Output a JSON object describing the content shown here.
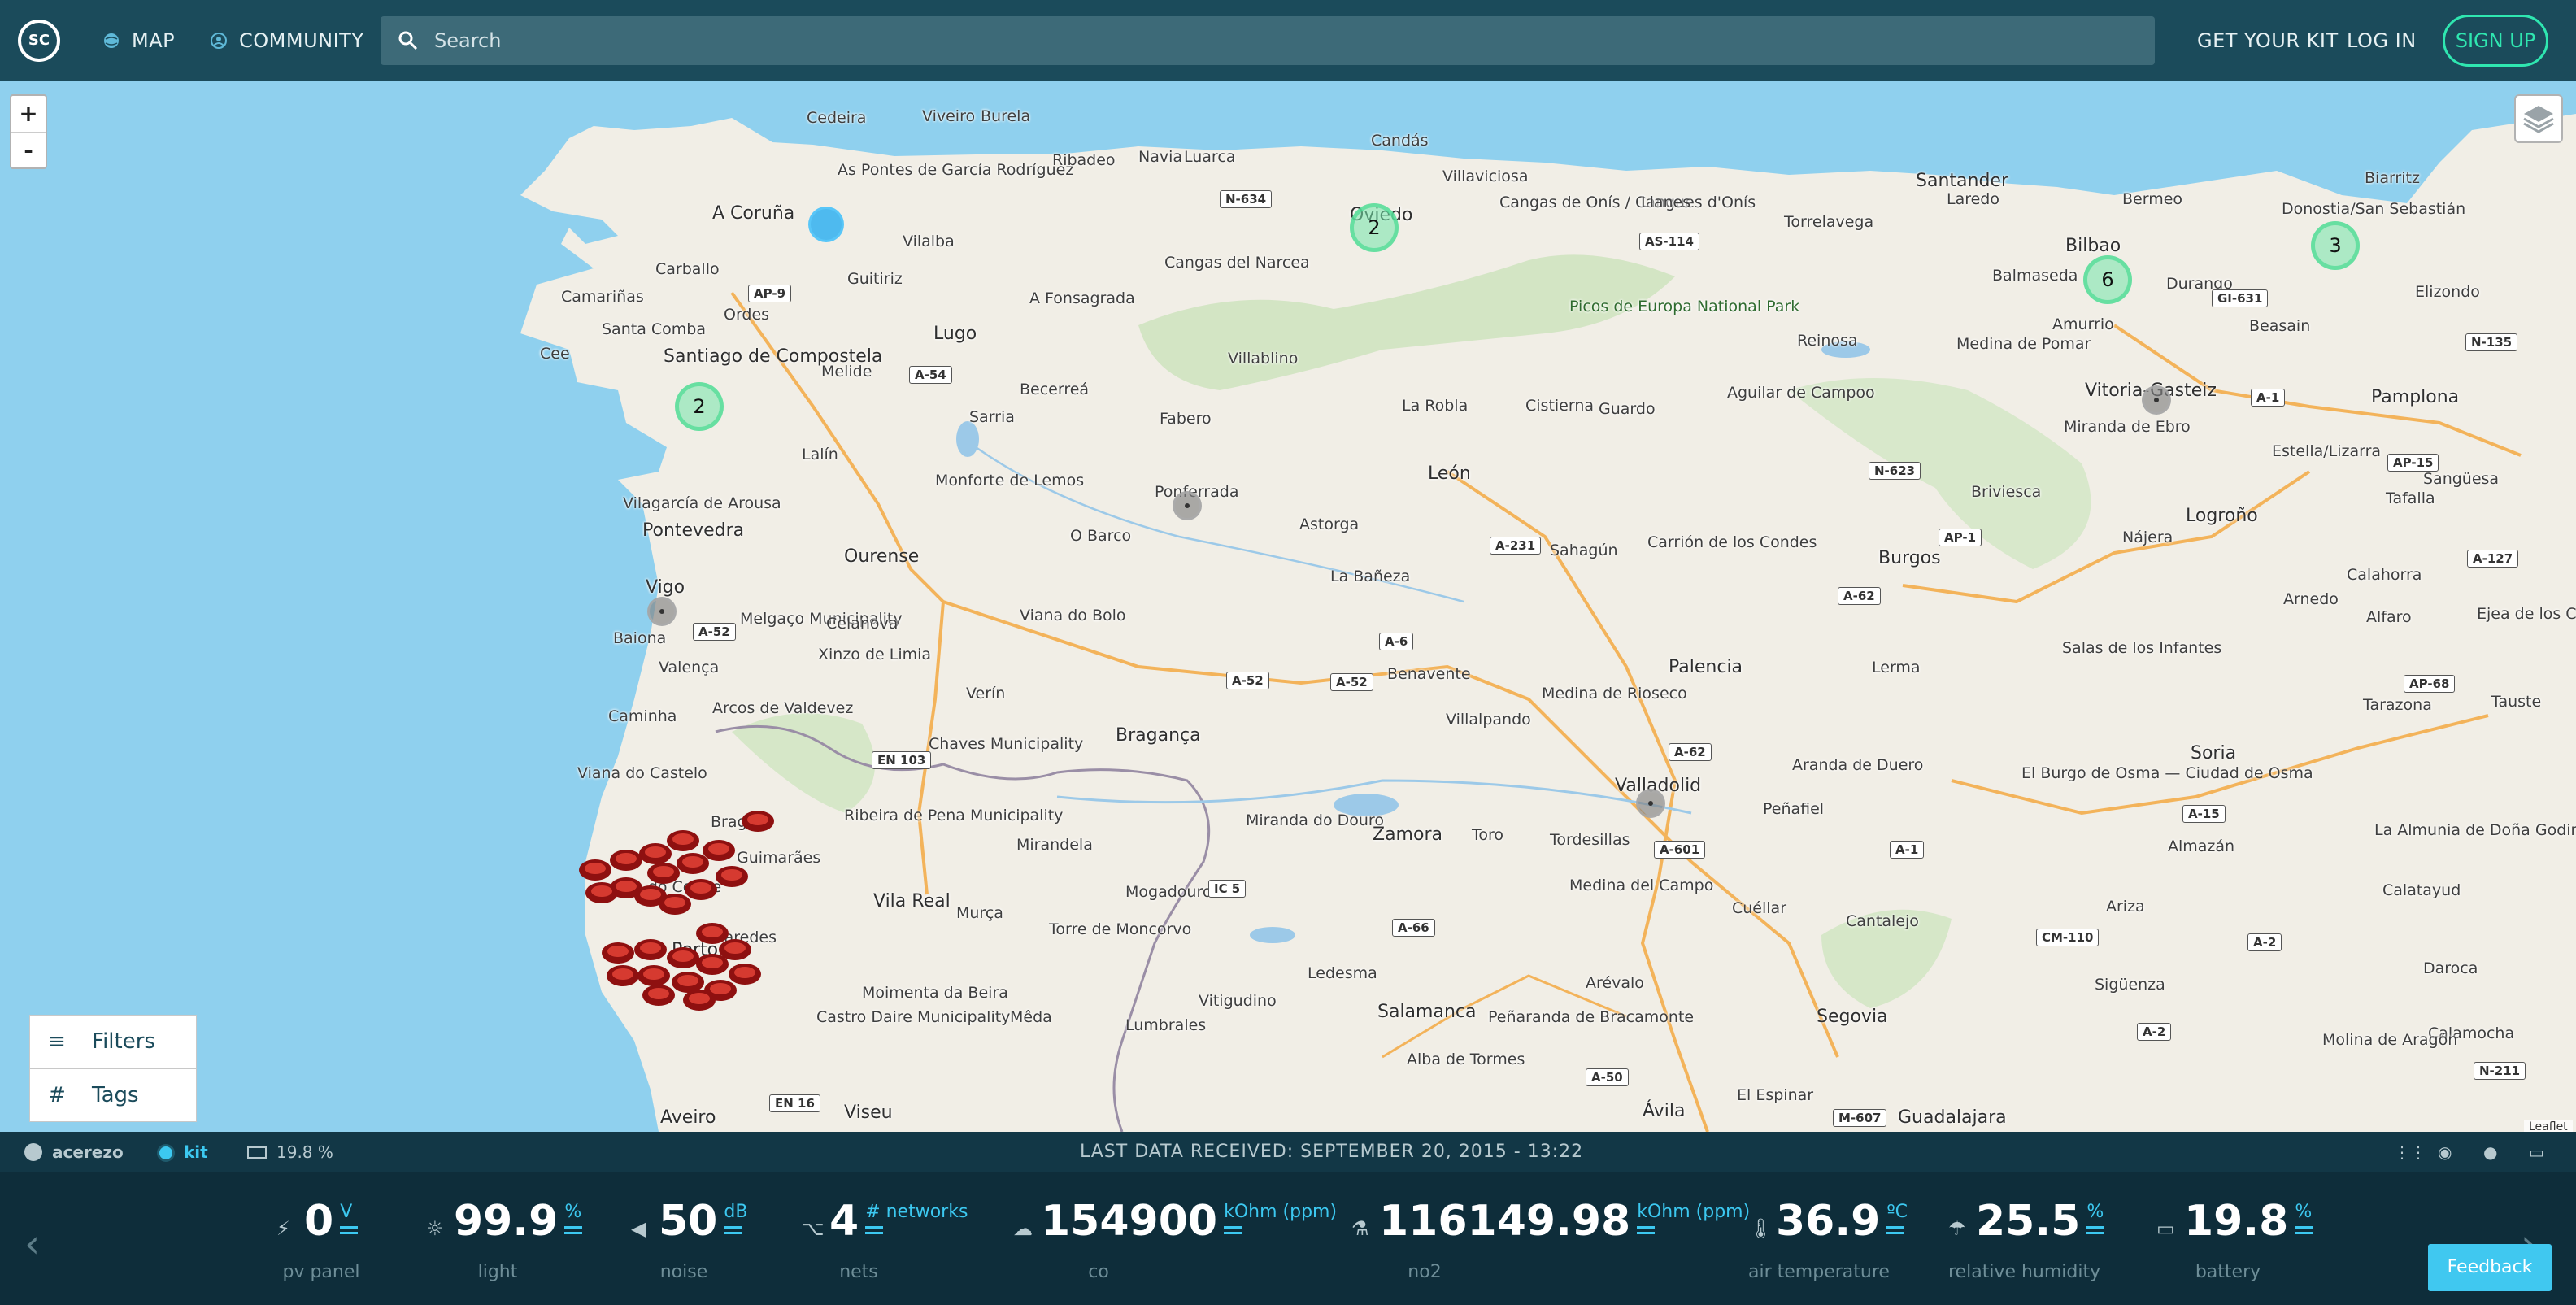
{
  "nav": {
    "logo": "SC",
    "map": "MAP",
    "community": "COMMUNITY",
    "search_placeholder": "Search",
    "get_kit": "GET YOUR KIT",
    "login": "LOG IN",
    "signup": "SIGN UP"
  },
  "map": {
    "zoom_in": "+",
    "zoom_out": "-",
    "attribution": "Leaflet",
    "clusters": [
      {
        "label": "2"
      },
      {
        "label": "2"
      },
      {
        "label": "6"
      },
      {
        "label": "3"
      }
    ],
    "places": [
      "Cedeira",
      "Viveiro",
      "Burela",
      "As Pontes de García Rodríguez",
      "Ribadeo",
      "Navia",
      "Luarca",
      "Candás",
      "Villaviciosa",
      "Oviedo",
      "Cangas de Onís / Cangues d'Onís",
      "Llanes",
      "Santander",
      "Laredo",
      "Bermeo",
      "Biarritz",
      "A Coruña",
      "Vilalba",
      "Donostia/San Sebastián",
      "Torrelavega",
      "Bilbao",
      "Carballo",
      "Guitiriz",
      "Cangas del Narcea",
      "Picos de Europa National Park",
      "Balmaseda",
      "Durango",
      "Camariñas",
      "Ordes",
      "A Fonsagrada",
      "Amurrio",
      "Elizondo",
      "Santa Comba",
      "Beasain",
      "Santiago de Compostela",
      "Lugo",
      "Villablino",
      "Reinosa",
      "Medina de Pomar",
      "Cee",
      "Melide",
      "Becerreá",
      "La Robla",
      "Cistierna",
      "Guardo",
      "Aguilar de Campoo",
      "Vitoria-Gasteiz",
      "Pamplona",
      "Sarria",
      "Fabero",
      "Miranda de Ebro",
      "Lalín",
      "Monforte de Lemos",
      "Ponferrada",
      "León",
      "Briviesca",
      "Estella/Lizarra",
      "Vilagarcía de Arousa",
      "Tafalla",
      "Sangüesa",
      "Pontevedra",
      "O Barco",
      "Astorga",
      "Sahagún",
      "Carrión de los Condes",
      "Burgos",
      "Nájera",
      "Logroño",
      "Ourense",
      "La Bañeza",
      "Calahorra",
      "Vigo",
      "Melgaço Municipality",
      "Celanova",
      "Viana do Bolo",
      "Arnedo",
      "Alfaro",
      "Ejea de los Caballeros",
      "Baiona",
      "Valença",
      "Xinzo de Limia",
      "Benavente",
      "Medina de Rioseco",
      "Palencia",
      "Lerma",
      "Salas de los Infantes",
      "Caminha",
      "Arcos de Valdevez",
      "Verín",
      "Villalpando",
      "Tarazona",
      "Tauste",
      "Bragança",
      "Chaves Municipality",
      "Viana do Castelo",
      "Valladolid",
      "Aranda de Duero",
      "Soria",
      "El Burgo de Osma — Ciudad de Osma",
      "Peñafiel",
      "Ribeira de Pena Municipality",
      "Braga",
      "Guimarães",
      "Miranda do Douro",
      "Mirandela",
      "Zamora",
      "Toro",
      "Tordesillas",
      "Almazán",
      "La Almunia de Doña Godina",
      "Vila do Conde",
      "Cuéllar",
      "Vila Real",
      "Mogadouro",
      "Medina del Campo",
      "Murça",
      "Paredes",
      "Cantalejo",
      "Calatayud",
      "Ariza",
      "Porto",
      "Torre de Moncorvo",
      "Ledesma",
      "Arévalo",
      "Sigüenza",
      "Daroca",
      "Salamanca",
      "Segovia",
      "Calamocha",
      "Vitigudino",
      "Moimenta da Beira",
      "Mêda",
      "Lumbrales",
      "Peñaranda de Bracamonte",
      "Castro Daire Municipality",
      "Alba de Tormes",
      "Molina de Aragón",
      "Aveiro",
      "Viseu",
      "El Espinar",
      "Ávila",
      "Guadalajara"
    ],
    "roads": [
      "N-634",
      "AS-114",
      "AP-9",
      "GI-631",
      "A-54",
      "N-135",
      "A-1",
      "AP-15",
      "N-623",
      "AP-1",
      "A-231",
      "A-127",
      "A-62",
      "A-52",
      "A-6",
      "A-52",
      "A-52",
      "AP-68",
      "EN 103",
      "A-62",
      "A-15",
      "A-601",
      "A-1",
      "IC 5",
      "A-66",
      "CM-110",
      "A-2",
      "A-2",
      "EN 16",
      "A-50",
      "M-607",
      "N-211"
    ]
  },
  "filters": {
    "filters_label": "Filters",
    "tags_label": "Tags"
  },
  "status": {
    "user": "acerezo",
    "kit": "kit",
    "battery": "19.8 %",
    "last_data": "LAST DATA RECEIVED: SEPTEMBER 20, 2015 - 13:22"
  },
  "sensors": [
    {
      "value": "0",
      "unit": "V",
      "name": "pv panel",
      "icon": "bolt-icon"
    },
    {
      "value": "99.9",
      "unit": "%",
      "name": "light",
      "icon": "sun-icon"
    },
    {
      "value": "50",
      "unit": "dB",
      "name": "noise",
      "icon": "speaker-icon"
    },
    {
      "value": "4",
      "unit": "# networks",
      "name": "nets",
      "icon": "network-icon"
    },
    {
      "value": "154900",
      "unit": "kOhm (ppm)",
      "name": "co",
      "icon": "cloud-icon"
    },
    {
      "value": "116149.98",
      "unit": "kOhm (ppm)",
      "name": "no2",
      "icon": "flask-icon"
    },
    {
      "value": "36.9",
      "unit": "ºC",
      "name": "air temperature",
      "icon": "thermometer-icon"
    },
    {
      "value": "25.5",
      "unit": "%",
      "name": "relative humidity",
      "icon": "humidity-icon"
    },
    {
      "value": "19.8",
      "unit": "%",
      "name": "battery",
      "icon": "battery-icon"
    }
  ],
  "feedback": "Feedback",
  "colors": {
    "header": "#1b4b5b",
    "accent": "#2fe6b0",
    "unit": "#3cc8f0",
    "sea": "#7fc8ea",
    "cluster": "#73e6aa"
  }
}
